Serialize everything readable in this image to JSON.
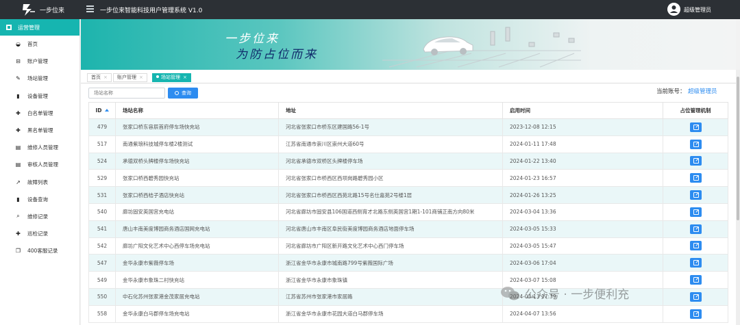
{
  "header": {
    "brand_name": "一步位来",
    "app_title": "一步位来智能科技用户管理系统 V1.0",
    "user_name": "超级管理员"
  },
  "sidebar": {
    "section_title": "运营管理",
    "items": [
      {
        "label": "首页",
        "icon": "gamepad-icon"
      },
      {
        "label": "账户管理",
        "icon": "car-icon"
      },
      {
        "label": "场站管理",
        "icon": "edit-icon"
      },
      {
        "label": "设备管理",
        "icon": "bar-chart-icon"
      },
      {
        "label": "白名单管理",
        "icon": "plus-icon"
      },
      {
        "label": "黑名单管理",
        "icon": "plus-icon"
      },
      {
        "label": "维修人员管理",
        "icon": "book-icon"
      },
      {
        "label": "审核人员管理",
        "icon": "book-icon"
      },
      {
        "label": "故障列表",
        "icon": "external-link-icon"
      },
      {
        "label": "设备查询",
        "icon": "bar-chart-icon"
      },
      {
        "label": "维修记录",
        "icon": "search-icon"
      },
      {
        "label": "巡检记录",
        "icon": "plus-icon"
      },
      {
        "label": "400客服记录",
        "icon": "copy-icon"
      }
    ]
  },
  "banner": {
    "slogan_line1": "一步位来",
    "slogan_line2": "为防占位而来"
  },
  "tabs": [
    {
      "label": "首页",
      "active": false
    },
    {
      "label": "账户管理",
      "active": false
    },
    {
      "label": "场站管理",
      "active": true
    }
  ],
  "toolbar": {
    "search_placeholder": "场站名称",
    "search_button": "查询",
    "account_label": "当前账号：",
    "account_name": "超级管理员"
  },
  "table": {
    "columns": [
      "ID",
      "场站名称",
      "地址",
      "启用时间",
      "占位管理机制"
    ],
    "rows": [
      {
        "id": "479",
        "name": "张家口桥东容辰首府停车场快充站",
        "address": "河北省张家口市桥东区建国路56-1号",
        "time": "2023-12-08 12:15"
      },
      {
        "id": "517",
        "name": "南通紫琅科技城停车楼2楼测试",
        "address": "江苏省南通市崇川区崇州大道60号",
        "time": "2024-01-11 17:48"
      },
      {
        "id": "524",
        "name": "承德双桥头牌楼停车场快充站",
        "address": "河北省承德市双桥区头牌楼停车场",
        "time": "2024-01-22 13:40"
      },
      {
        "id": "529",
        "name": "张家口桥西碧秀园快充站",
        "address": "河北省张家口市桥西区西坝岗路碧秀园小区",
        "time": "2024-01-23 16:57"
      },
      {
        "id": "531",
        "name": "张家口桥西桔子酒店快充站",
        "address": "河北省张家口市桥西区西苑北路15号名仕嘉苑2号楼1层",
        "time": "2024-01-26 13:25"
      },
      {
        "id": "540",
        "name": "廊坊固安英国宫充电站",
        "address": "河北省廊坊市固安县106国道西侧育才北路东侧英国宫1期1-101商铺正南方向80米",
        "time": "2024-03-04 13:36"
      },
      {
        "id": "541",
        "name": "唐山丰南美度博园商务酒店国网充电站",
        "address": "河北省唐山市丰南区阜民街美度博园商务酒店地面停车场",
        "time": "2024-03-05 15:33"
      },
      {
        "id": "542",
        "name": "廊坊广阳文化艺术中心西停车场充电站",
        "address": "河北省廊坊市广阳区新开路文化艺术中心西门停车场",
        "time": "2024-03-05 15:47"
      },
      {
        "id": "547",
        "name": "金华永康市紫薇停车场",
        "address": "浙江省金华市永康市城南路799号紫薇国际广场",
        "time": "2024-03-06 17:04"
      },
      {
        "id": "549",
        "name": "金华永康市象珠二村快充站",
        "address": "浙江省金华市永康市象珠镇",
        "time": "2024-03-07 15:08"
      },
      {
        "id": "550",
        "name": "中石化苏州张家港金茂家居充电站",
        "address": "江苏省苏州市张家港市家居路",
        "time": "2024-03-13 17:39"
      },
      {
        "id": "558",
        "name": "金华永康白马郡停车场充电站",
        "address": "浙江省金华市永康市花园大道白马郡停车场",
        "time": "2024-04-07 13:56"
      }
    ]
  },
  "watermark": "公众号 · 一步便利充",
  "colors": {
    "accent": "#16b5b0",
    "primary": "#2d8cf0",
    "topbar": "#2c3035"
  }
}
